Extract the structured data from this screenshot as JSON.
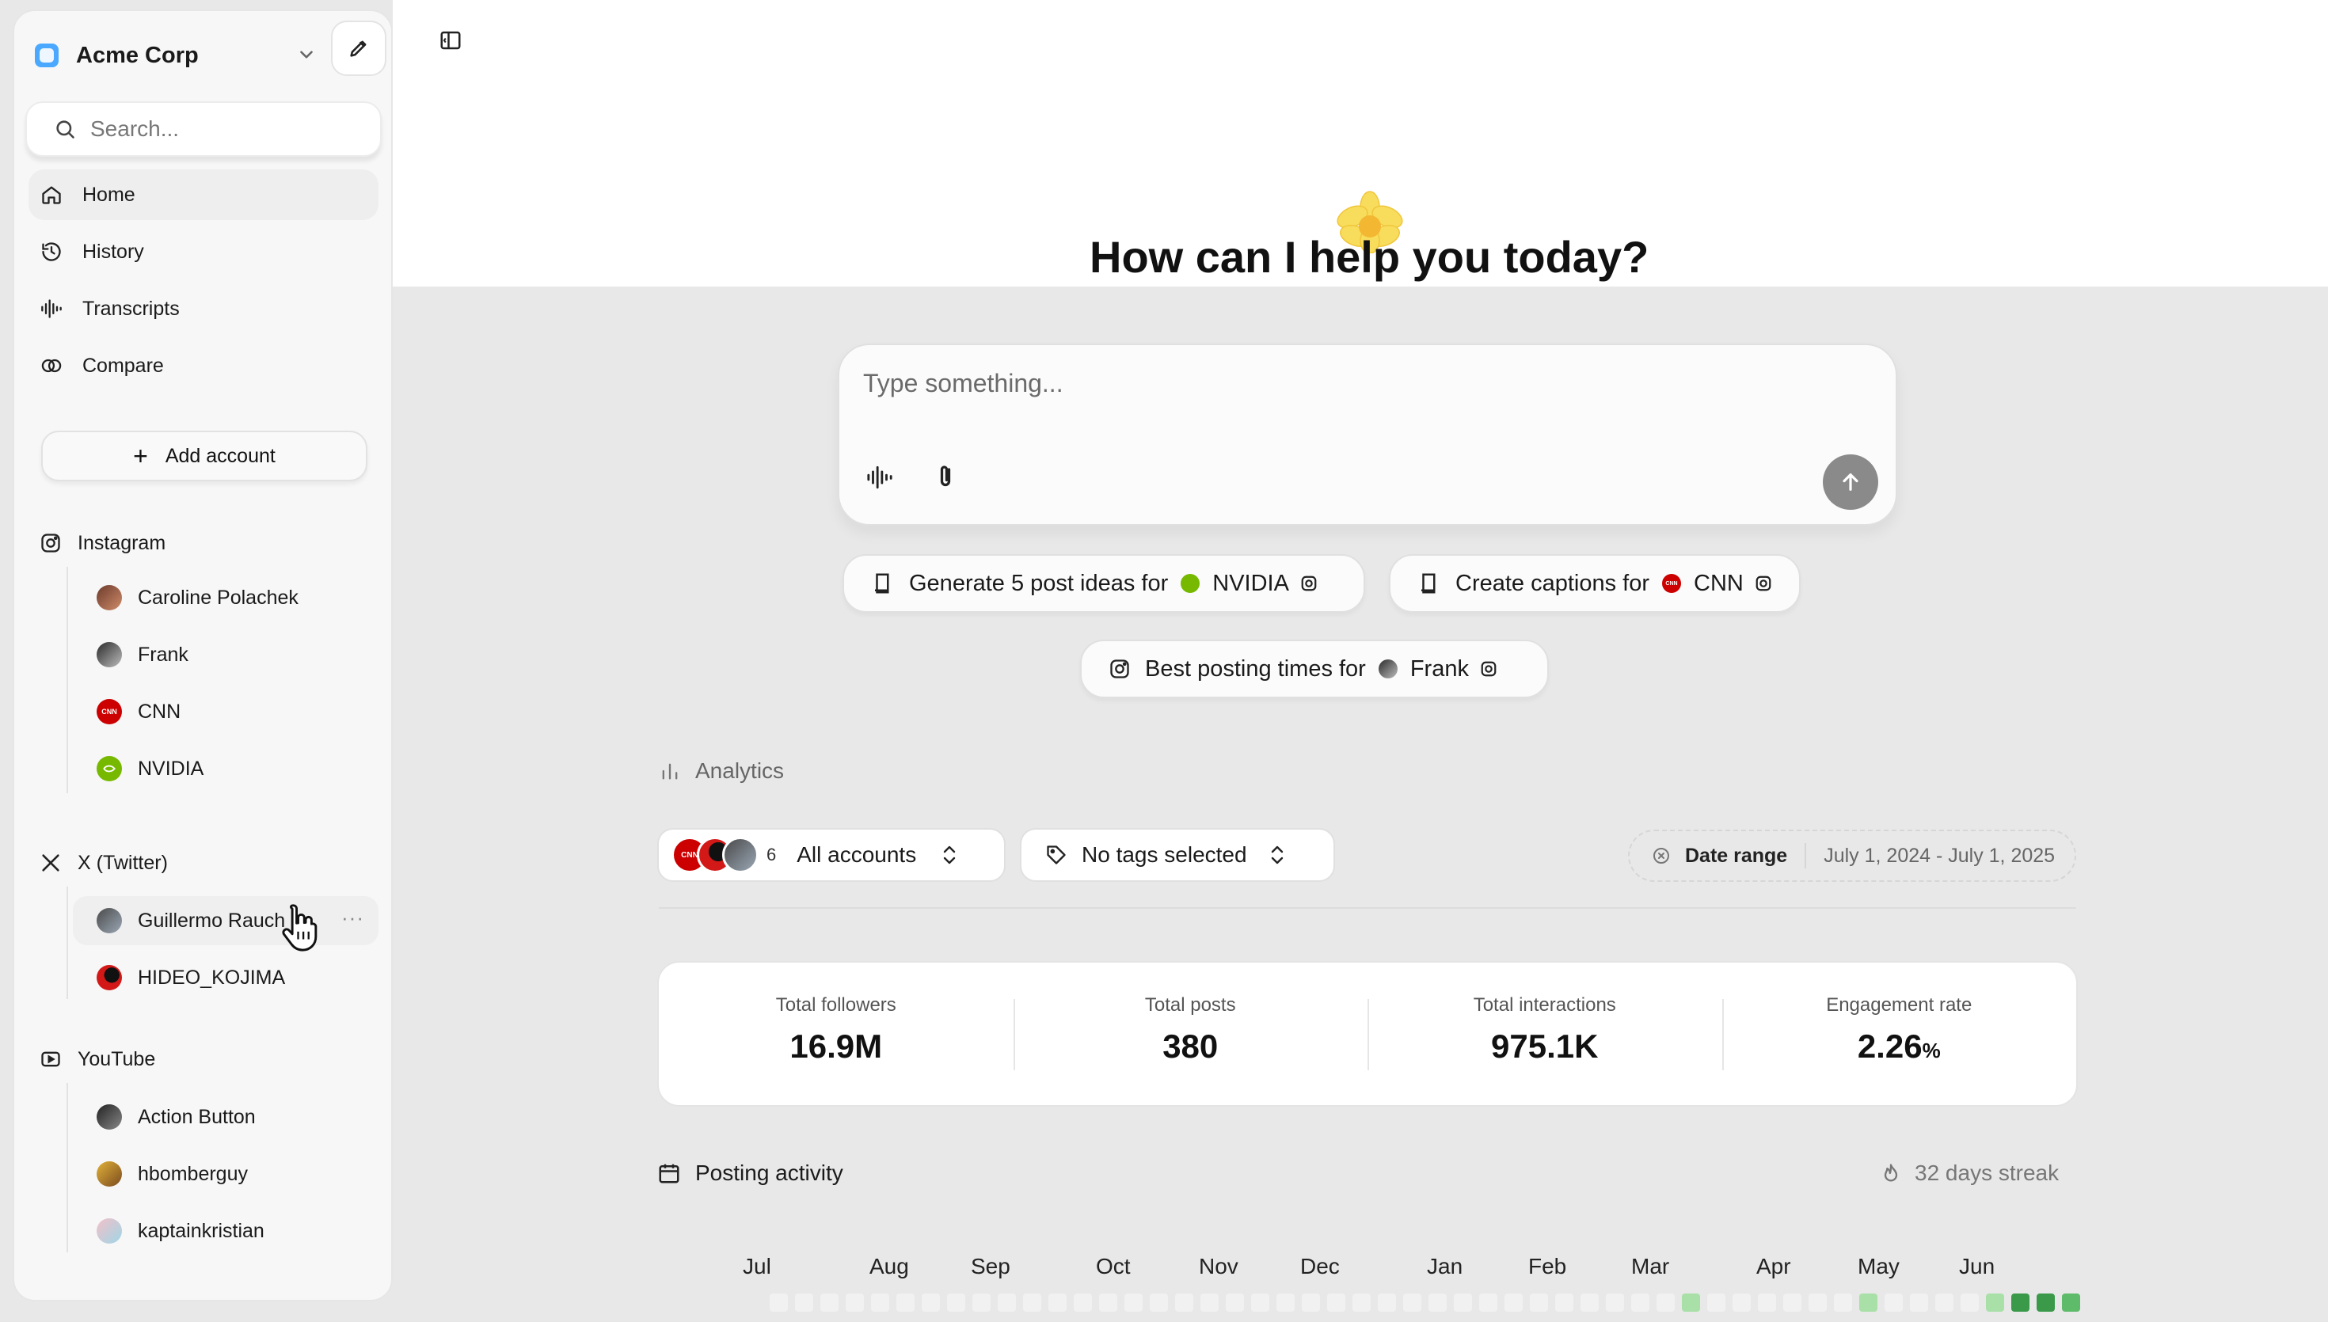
{
  "workspace": {
    "name": "Acme Corp"
  },
  "search": {
    "placeholder": "Search..."
  },
  "nav": [
    {
      "label": "Home",
      "icon": "home-icon",
      "active": true
    },
    {
      "label": "History",
      "icon": "history-icon"
    },
    {
      "label": "Transcripts",
      "icon": "waveform-icon"
    },
    {
      "label": "Compare",
      "icon": "compare-icon"
    }
  ],
  "add_account_label": "Add account",
  "platforms": {
    "instagram": {
      "label": "Instagram",
      "accounts": [
        "Caroline Polachek",
        "Frank",
        "CNN",
        "NVIDIA"
      ]
    },
    "x": {
      "label": "X (Twitter)",
      "accounts": [
        "Guillermo Rauch",
        "HIDEO_KOJIMA"
      ]
    },
    "youtube": {
      "label": "YouTube",
      "accounts": [
        "Action Button",
        "hbomberguy",
        "kaptainkristian"
      ]
    }
  },
  "account_more": "···",
  "avatar_text": {
    "cnn": "CNN"
  },
  "main": {
    "greeting": "How can I help you today?",
    "composer_placeholder": "Type something..."
  },
  "suggestions": [
    {
      "text": "Generate 5 post ideas for",
      "account": "NVIDIA"
    },
    {
      "text": "Create captions for",
      "account": "CNN"
    },
    {
      "text": "Best posting times for",
      "account": "Frank"
    }
  ],
  "analytics": {
    "title": "Analytics",
    "accounts_filter": {
      "count": "6",
      "label": "All accounts"
    },
    "tags_filter": {
      "label": "No tags selected"
    },
    "date_range": {
      "label": "Date range",
      "value": "July 1, 2024 - July 1, 2025"
    },
    "stats": [
      {
        "label": "Total followers",
        "value": "16.9M"
      },
      {
        "label": "Total posts",
        "value": "380"
      },
      {
        "label": "Total interactions",
        "value": "975.1K"
      },
      {
        "label": "Engagement rate",
        "value": "2.26",
        "unit": "%"
      }
    ]
  },
  "posting_activity": {
    "title": "Posting activity",
    "streak": "32 days streak",
    "months": [
      "Jul",
      "Aug",
      "Sep",
      "Oct",
      "Nov",
      "Dec",
      "Jan",
      "Feb",
      "Mar",
      "Apr",
      "May",
      "Jun"
    ],
    "week_levels": [
      0,
      0,
      0,
      0,
      0,
      0,
      0,
      0,
      0,
      0,
      0,
      0,
      0,
      0,
      0,
      0,
      0,
      0,
      0,
      0,
      0,
      0,
      0,
      0,
      0,
      0,
      0,
      0,
      0,
      0,
      0,
      0,
      0,
      0,
      0,
      0,
      1,
      0,
      0,
      0,
      0,
      0,
      0,
      1,
      0,
      0,
      0,
      0,
      1,
      3,
      3,
      2
    ]
  },
  "colors": {
    "accent": "#4aa8ff",
    "send": "#8a8a8a",
    "heat_low": "#a8e0a8",
    "heat_high": "#3a9a4a",
    "cnn_red": "#cc0000",
    "nvidia_green": "#76b900"
  }
}
